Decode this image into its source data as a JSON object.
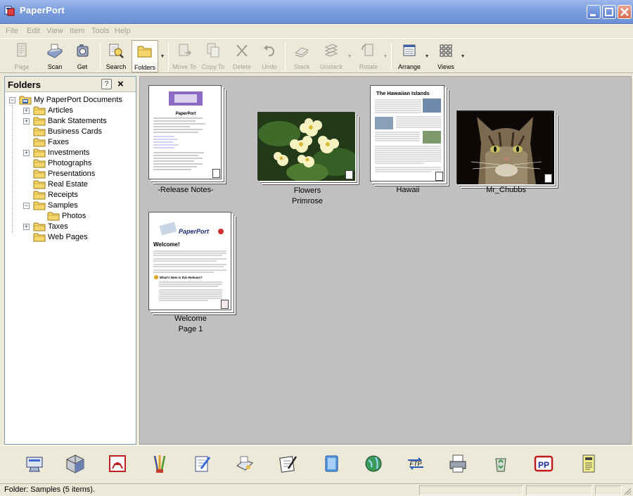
{
  "window": {
    "title": "PaperPort"
  },
  "menu": [
    "File",
    "Edit",
    "View",
    "Item",
    "Tools",
    "Help"
  ],
  "toolbar": {
    "page": "Page",
    "scan": "Scan",
    "get": "Get",
    "search": "Search",
    "folders": "Folders",
    "move_to": "Move To",
    "copy_to": "Copy To",
    "delete": "Delete",
    "undo": "Undo",
    "stack": "Stack",
    "unstack": "Unstack",
    "rotate": "Rotate",
    "arrange": "Arrange",
    "views": "Views"
  },
  "folders": {
    "title": "Folders",
    "help": "?",
    "close": "×",
    "tree": [
      {
        "label": "My PaperPort Documents",
        "level": 0,
        "expander": "−"
      },
      {
        "label": "Articles",
        "level": 1,
        "expander": "+"
      },
      {
        "label": "Bank Statements",
        "level": 1,
        "expander": "+"
      },
      {
        "label": "Business Cards",
        "level": 1,
        "expander": ""
      },
      {
        "label": "Faxes",
        "level": 1,
        "expander": ""
      },
      {
        "label": "Investments",
        "level": 1,
        "expander": "+"
      },
      {
        "label": "Photographs",
        "level": 1,
        "expander": ""
      },
      {
        "label": "Presentations",
        "level": 1,
        "expander": ""
      },
      {
        "label": "Real Estate",
        "level": 1,
        "expander": ""
      },
      {
        "label": "Receipts",
        "level": 1,
        "expander": ""
      },
      {
        "label": "Samples",
        "level": 1,
        "expander": "−"
      },
      {
        "label": "Photos",
        "level": 2,
        "expander": ""
      },
      {
        "label": "Taxes",
        "level": 1,
        "expander": "+"
      },
      {
        "label": "Web Pages",
        "level": 1,
        "expander": ""
      }
    ]
  },
  "items": [
    {
      "caption1": "-Release Notes-",
      "caption2": "",
      "doc_heading": "PaperPort"
    },
    {
      "caption1": "Flowers",
      "caption2": "Primrose"
    },
    {
      "caption1": "Hawaii",
      "caption2": "",
      "doc_heading": "The Hawaiian Islands"
    },
    {
      "caption1": "Mr_Chubbs",
      "caption2": ""
    },
    {
      "caption1": "Welcome",
      "caption2": "Page 1",
      "doc_logo": "PaperPort",
      "doc_heading": "Welcome!",
      "doc_subheading": "What's New in this Release?"
    }
  ],
  "appbar": {
    "icons": [
      "scanner-settings-icon",
      "cube-app-icon",
      "pdf-app-icon",
      "brushes-app-icon",
      "notepad-app-icon",
      "imaging-app-icon",
      "writer-app-icon",
      "notebook-app-icon",
      "web-globe-icon",
      "ftp-app-icon",
      "printer-app-icon",
      "recycle-app-icon",
      "pp-app-icon",
      "document-app-icon"
    ],
    "ftp_label": "FTP",
    "pp_label": "PP"
  },
  "status": {
    "text": "Folder: Samples (5 items)."
  },
  "colors": {
    "title_bar": "#7c9fdf",
    "content_bg": "#c0c0c0",
    "folder_yellow": "#f5d66b"
  }
}
